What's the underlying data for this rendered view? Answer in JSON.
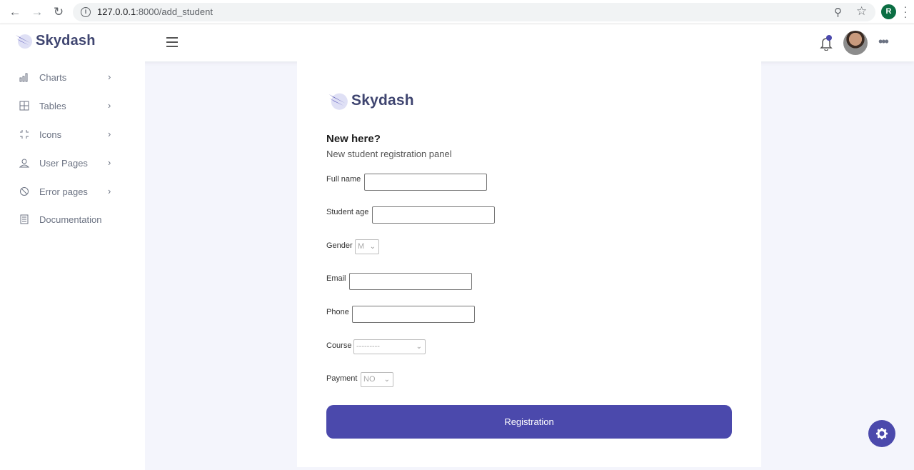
{
  "browser": {
    "url_host": "127.0.0.1",
    "url_path": ":8000/add_student",
    "profile_initial": "R"
  },
  "app": {
    "brand": "Skydash"
  },
  "sidebar": {
    "items": [
      {
        "label": "Charts",
        "icon": "bar-chart-icon",
        "has_chevron": true
      },
      {
        "label": "Tables",
        "icon": "grid-icon",
        "has_chevron": true
      },
      {
        "label": "Icons",
        "icon": "expand-icon",
        "has_chevron": true
      },
      {
        "label": "User Pages",
        "icon": "user-icon",
        "has_chevron": true
      },
      {
        "label": "Error pages",
        "icon": "ban-icon",
        "has_chevron": true
      },
      {
        "label": "Documentation",
        "icon": "document-icon",
        "has_chevron": false
      }
    ]
  },
  "form": {
    "brand": "Skydash",
    "heading": "New here?",
    "subheading": "New student registration panel",
    "full_name_label": "Full name",
    "full_name_value": "",
    "age_label": "Student age",
    "age_value": "",
    "gender_label": "Gender",
    "gender_value": "M",
    "email_label": "Email",
    "email_value": "",
    "phone_label": "Phone",
    "phone_value": "",
    "course_label": "Course",
    "course_value": "---------",
    "payment_label": "Payment",
    "payment_value": "NO",
    "submit_label": "Registration"
  },
  "colors": {
    "accent": "#4b49ac",
    "brand_text": "#3f4570",
    "page_bg": "#f4f5fc"
  }
}
